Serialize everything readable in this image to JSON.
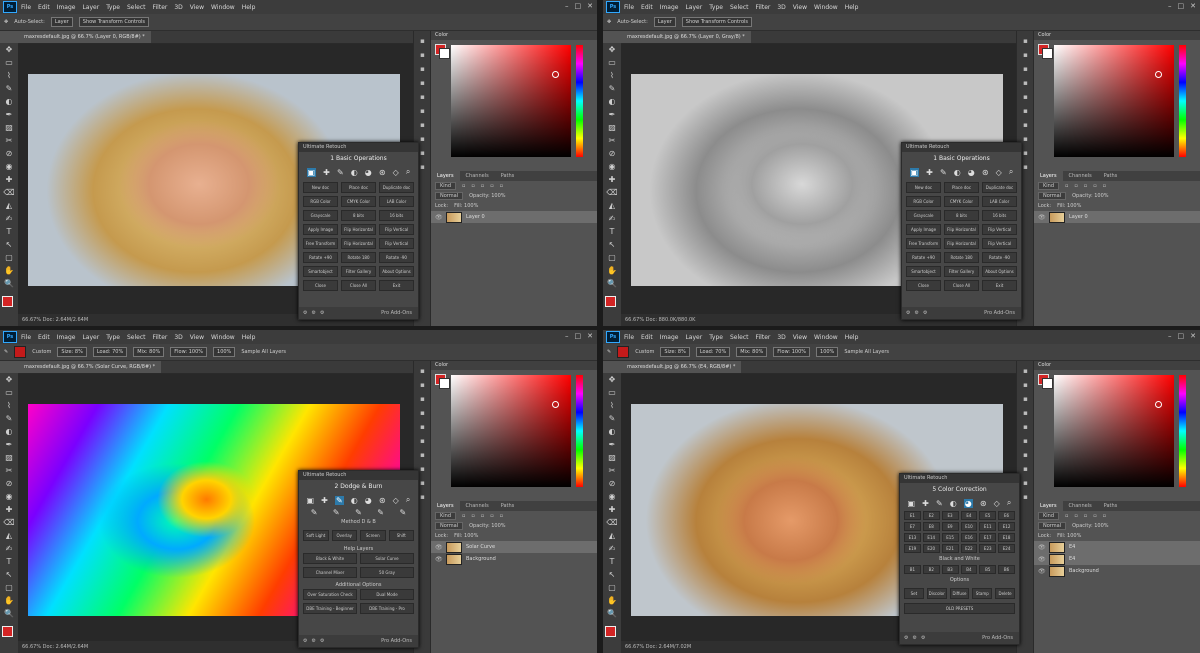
{
  "menu": [
    "File",
    "Edit",
    "Image",
    "Layer",
    "Type",
    "Select",
    "Filter",
    "3D",
    "View",
    "Window",
    "Help"
  ],
  "app_badge": "Ps",
  "windows": [
    {
      "tab": "maxresdefault.jpg @ 66.7% (Layer 0, RGB/8#) *",
      "status": "66.67%    Doc: 2.64M/2.64M",
      "opts": [
        "Auto-Select:",
        "Layer",
        "Show Transform Controls"
      ],
      "layers": [
        {
          "name": "Layer 0",
          "sel": true
        }
      ],
      "panel": {
        "title": "Ultimate Retouch",
        "section": "1 Basic Operations",
        "buttons": [
          "New doc",
          "Place doc",
          "Duplicate doc",
          "RGB Color",
          "CMYK Color",
          "LAB Color",
          "Grayscale",
          "8 bits",
          "16 bits",
          "Apply Image",
          "Flip Horizontal",
          "Flip Vertical",
          "Free Transform",
          "Flip Horizontal",
          "Flip Vertical",
          "Rotate +90",
          "Rotate 180",
          "Rotate -90",
          "Smartobject",
          "Filter Gallery",
          "About Options",
          "Close",
          "Close All",
          "Exit"
        ],
        "footer": "Pro Add-Ons"
      }
    },
    {
      "tab": "maxresdefault.jpg @ 66.7% (Layer 0, Gray/8) *",
      "status": "66.67%    Doc: 880.0K/880.0K",
      "opts": [
        "Auto-Select:",
        "Layer",
        "Show Transform Controls"
      ],
      "layers": [
        {
          "name": "Layer 0",
          "sel": true
        }
      ],
      "panel": {
        "title": "Ultimate Retouch",
        "section": "1 Basic Operations",
        "buttons": [
          "New doc",
          "Place doc",
          "Duplicate doc",
          "RGB Color",
          "CMYK Color",
          "LAB Color",
          "Grayscale",
          "8 bits",
          "16 bits",
          "Apply Image",
          "Flip Horizontal",
          "Flip Vertical",
          "Free Transform",
          "Flip Horizontal",
          "Flip Vertical",
          "Rotate +90",
          "Rotate 180",
          "Rotate -90",
          "Smartobject",
          "Filter Gallery",
          "About Options",
          "Close",
          "Close All",
          "Exit"
        ],
        "footer": "Pro Add-Ons"
      }
    },
    {
      "tab": "maxresdefault.jpg @ 66.7% (Solar Curve, RGB/8#) *",
      "status": "66.67%    Doc: 2.64M/2.64M",
      "opts": [
        "Custom",
        "Size: 8%",
        "Load: 70%",
        "Mix: 80%",
        "Flow: 100%",
        "100%",
        "Sample All Layers"
      ],
      "layers": [
        {
          "name": "Solar Curve",
          "sel": true
        },
        {
          "name": "Background",
          "sel": false
        }
      ],
      "panel": {
        "title": "Ultimate Retouch",
        "section": "2 Dodge & Burn",
        "method": "Method D & B",
        "buttons2": [
          "Soft Light",
          "Overlay",
          "Screen",
          "Shift"
        ],
        "help": "Help Layers",
        "helpbtns": [
          "Black & White",
          "Solar Curve",
          "Channel Mixer",
          "50 Gray"
        ],
        "addl": "Additional Options",
        "addbtns": [
          "Over Saturation Check",
          "Dual Mode",
          "DBE Training - Beginner",
          "DBE Training - Pro"
        ],
        "footer": "Pro Add-Ons"
      }
    },
    {
      "tab": "maxresdefault.jpg @ 66.7% (E4, RGB/8#) *",
      "status": "66.67%    Doc: 2.64M/7.02M",
      "opts": [
        "Custom",
        "Size: 8%",
        "Load: 70%",
        "Mix: 80%",
        "Flow: 100%",
        "100%",
        "Sample All Layers"
      ],
      "layers": [
        {
          "name": "E4",
          "sel": true
        },
        {
          "name": "E4",
          "sel": true
        },
        {
          "name": "Background",
          "sel": false
        }
      ],
      "panel": {
        "title": "Ultimate Retouch",
        "section": "5 Color Correction",
        "codes": [
          "E1",
          "E2",
          "E3",
          "E4",
          "E5",
          "E6",
          "E7",
          "E8",
          "E9",
          "E10",
          "E11",
          "E12",
          "E13",
          "E14",
          "E15",
          "E16",
          "E17",
          "E18",
          "E19",
          "E20",
          "E21",
          "E22",
          "E23",
          "E24"
        ],
        "bw": "Black and White",
        "bwcodes": [
          "B1",
          "B2",
          "B3",
          "B4",
          "B5",
          "B6"
        ],
        "opts_label": "Options",
        "optbtns": [
          "Set",
          "Discolor",
          "Diffuse",
          "Stamp",
          "Delete"
        ],
        "presets": "OLD PRESETS",
        "footer": "Pro Add-Ons"
      }
    }
  ],
  "panels": {
    "color": "Color",
    "layers_tabs": [
      "Layers",
      "Channels",
      "Paths"
    ],
    "kind": "Kind",
    "blend": "Normal",
    "opacity": "Opacity: 100%",
    "lock": "Lock:",
    "fill": "Fill: 100%"
  }
}
